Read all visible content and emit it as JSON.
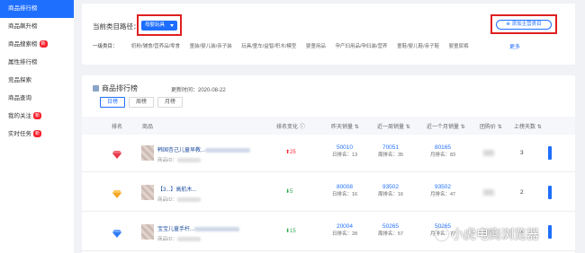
{
  "sidebar": {
    "items": [
      {
        "label": "商品排行榜",
        "active": true,
        "badge": ""
      },
      {
        "label": "商品飙升榜",
        "active": false,
        "badge": ""
      },
      {
        "label": "商品搜索榜",
        "active": false,
        "badge": "新"
      },
      {
        "label": "属性排行榜",
        "active": false,
        "badge": ""
      },
      {
        "label": "竞品探索",
        "active": false,
        "badge": ""
      },
      {
        "label": "商品查询",
        "active": false,
        "badge": ""
      },
      {
        "label": "我的关注",
        "active": false,
        "badge": "新"
      },
      {
        "label": "实时任务",
        "active": false,
        "badge": "新"
      }
    ]
  },
  "filter": {
    "path_label": "当前类目路径：",
    "path_value": "母婴玩具",
    "add_button": "添加主营类目",
    "category_label": "一级类目：",
    "categories": [
      "奶粉/辅食/营养品/零食",
      "童装/婴儿装/亲子装",
      "玩具/童车/益智/积木/模型",
      "婴童用品",
      "孕产妇用品/孕妇装/营养",
      "童鞋/婴儿鞋/亲子鞋",
      "婴童尿裤"
    ],
    "more": "更多"
  },
  "ranking": {
    "title": "商品排行榜",
    "update_time": "更新时间：2020-08-22",
    "tabs": [
      "日榜",
      "周榜",
      "月榜"
    ],
    "active_tab": 0,
    "headers": {
      "rank": "排名",
      "product": "商品",
      "rank_change": "排名变化",
      "sales": "昨天销量",
      "sales_week": "近一周销量",
      "sales_month": "近一个月销量",
      "price": "团购价",
      "days": "上榜天数"
    },
    "rows": [
      {
        "rank_icon": "ruby-diamond-icon",
        "rank_color": "#e8394a",
        "name": "韩国杏己儿童早教...",
        "id": "商品ID：",
        "change": "25",
        "dir": "up",
        "sales": "50010",
        "sales_rank": "日排名：13",
        "week": "70051",
        "week_rank": "周排名：35",
        "month": "80165",
        "month_rank": "月排名：83",
        "days": "3"
      },
      {
        "rank_icon": "gold-diamond-icon",
        "rank_color": "#f5a623",
        "name": "【3...】高航木...",
        "id": "商品ID：",
        "change": "5",
        "dir": "down",
        "sales": "80008",
        "sales_rank": "日排名：16",
        "week": "93502",
        "week_rank": "周排名：16",
        "month": "93502",
        "month_rank": "月排名：47",
        "days": "2"
      },
      {
        "rank_icon": "blue-diamond-icon",
        "rank_color": "#2f7bf5",
        "name": "宝宝儿童手杆...",
        "id": "商品ID：",
        "change": "15",
        "dir": "down",
        "sales": "20004",
        "sales_rank": "日排名：28",
        "week": "50265",
        "week_rank": "周排名：57",
        "month": "50265",
        "month_rank": "月排名：77",
        "days": "1"
      }
    ]
  },
  "watermark": "小虎电商浏览器"
}
